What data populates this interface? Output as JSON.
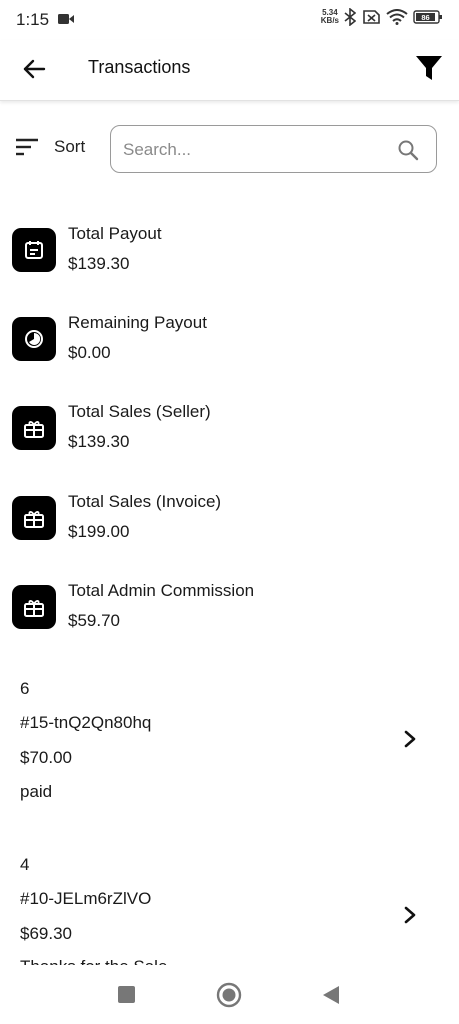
{
  "status_bar": {
    "time": "1:15",
    "net_speed_value": "5.34",
    "net_speed_unit": "KB/s",
    "battery": "86"
  },
  "app_bar": {
    "title": "Transactions"
  },
  "toolbar": {
    "sort_label": "Sort",
    "search_placeholder": "Search..."
  },
  "summary": [
    {
      "label": "Total Payout",
      "value": "$139.30",
      "icon": "calendar-icon"
    },
    {
      "label": "Remaining Payout",
      "value": "$0.00",
      "icon": "clock-icon"
    },
    {
      "label": "Total Sales (Seller)",
      "value": "$139.30",
      "icon": "gift-icon"
    },
    {
      "label": "Total Sales (Invoice)",
      "value": "$199.00",
      "icon": "gift-icon"
    },
    {
      "label": "Total Admin Commission",
      "value": "$59.70",
      "icon": "gift-icon"
    }
  ],
  "transactions": [
    {
      "id": "6",
      "ref": "#15-tnQ2Qn80hq",
      "amount": "$70.00",
      "note": "paid"
    },
    {
      "id": "4",
      "ref": "#10-JELm6rZlVO",
      "amount": "$69.30",
      "note": "Thanks for the Sale"
    }
  ],
  "colors": {
    "icon_bg": "#000000",
    "text": "#1a1a1a",
    "placeholder": "#8a8a8a"
  }
}
